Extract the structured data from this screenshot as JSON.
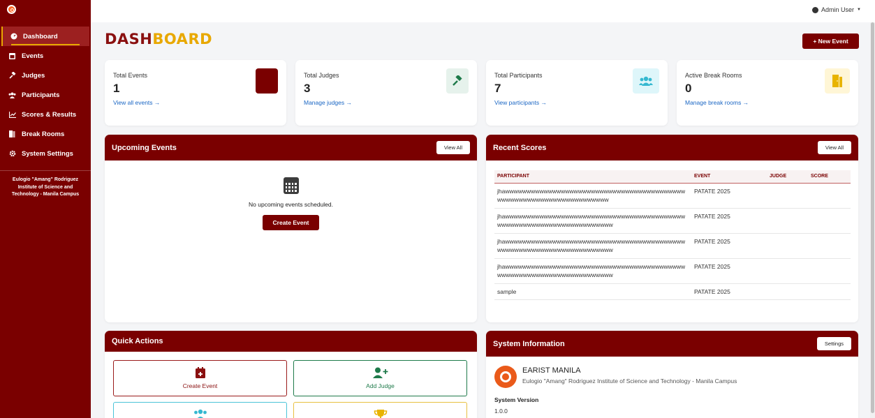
{
  "sidebar": {
    "items": [
      {
        "label": "Dashboard",
        "icon": "dashboard-icon",
        "active": true
      },
      {
        "label": "Events",
        "icon": "calendar-icon"
      },
      {
        "label": "Judges",
        "icon": "gavel-icon"
      },
      {
        "label": "Participants",
        "icon": "users-icon"
      },
      {
        "label": "Scores & Results",
        "icon": "chart-icon"
      },
      {
        "label": "Break Rooms",
        "icon": "door-icon"
      },
      {
        "label": "System Settings",
        "icon": "gear-icon"
      }
    ],
    "institution": "Eulogio \"Amang\" Rodriguez Institute of Science and Technology - Manila Campus"
  },
  "topbar": {
    "user": "Admin User"
  },
  "header": {
    "title_part1": "DASH",
    "title_part2": "BOARD",
    "new_event_label": "+ New Event"
  },
  "stats": [
    {
      "label": "Total Events",
      "value": "1",
      "link": "View all events →"
    },
    {
      "label": "Total Judges",
      "value": "3",
      "link": "Manage judges →"
    },
    {
      "label": "Total Participants",
      "value": "7",
      "link": "View participants →"
    },
    {
      "label": "Active Break Rooms",
      "value": "0",
      "link": "Manage break rooms →"
    }
  ],
  "upcoming": {
    "title": "Upcoming Events",
    "view_all": "View All",
    "empty_text": "No upcoming events scheduled.",
    "create_label": "Create Event"
  },
  "recent": {
    "title": "Recent Scores",
    "view_all": "View All",
    "columns": [
      "PARTICIPANT",
      "EVENT",
      "JUDGE",
      "SCORE"
    ],
    "rows": [
      {
        "participant": "jhawwwwwwwwwwwwwwwwwwwwwwwwwwwwwwwwwwwwwwwwwwwwwwwwwwwwwwwwwwwwwwwwwwww",
        "event": "PATATE 2025",
        "judge": "",
        "score": ""
      },
      {
        "participant": "jhawwwwwwwwwwwwwwwwwwwwwwwwwwwwwwwwwwwwwwwwwwwwwwwwwwwwwwwwwwwwwwwwwwwww",
        "event": "PATATE 2025",
        "judge": "",
        "score": ""
      },
      {
        "participant": "jhawwwwwwwwwwwwwwwwwwwwwwwwwwwwwwwwwwwwwwwwwwwwwwwwwwwwwwwwwwwwwwwwwwwww",
        "event": "PATATE 2025",
        "judge": "",
        "score": ""
      },
      {
        "participant": "jhawwwwwwwwwwwwwwwwwwwwwwwwwwwwwwwwwwwwwwwwwwwwwwwwwwwwwwwwwwwwwwwwwwwww",
        "event": "PATATE 2025",
        "judge": "",
        "score": ""
      },
      {
        "participant": "sample",
        "event": "PATATE 2025",
        "judge": "",
        "score": ""
      }
    ]
  },
  "quick_actions": {
    "title": "Quick Actions",
    "create_event": "Create Event",
    "add_judge": "Add Judge"
  },
  "system_info": {
    "title": "System Information",
    "settings_label": "Settings",
    "name": "EARIST MANILA",
    "subtitle": "Eulogio \"Amang\" Rodriguez Institute of Science and Technology - Manila Campus",
    "version_label": "System Version",
    "version": "1.0.0"
  },
  "colors": {
    "primary": "#7a0000",
    "accent": "#e8a800",
    "link": "#1a66c4",
    "green": "#1e7a4a",
    "teal": "#4ac4d8"
  }
}
